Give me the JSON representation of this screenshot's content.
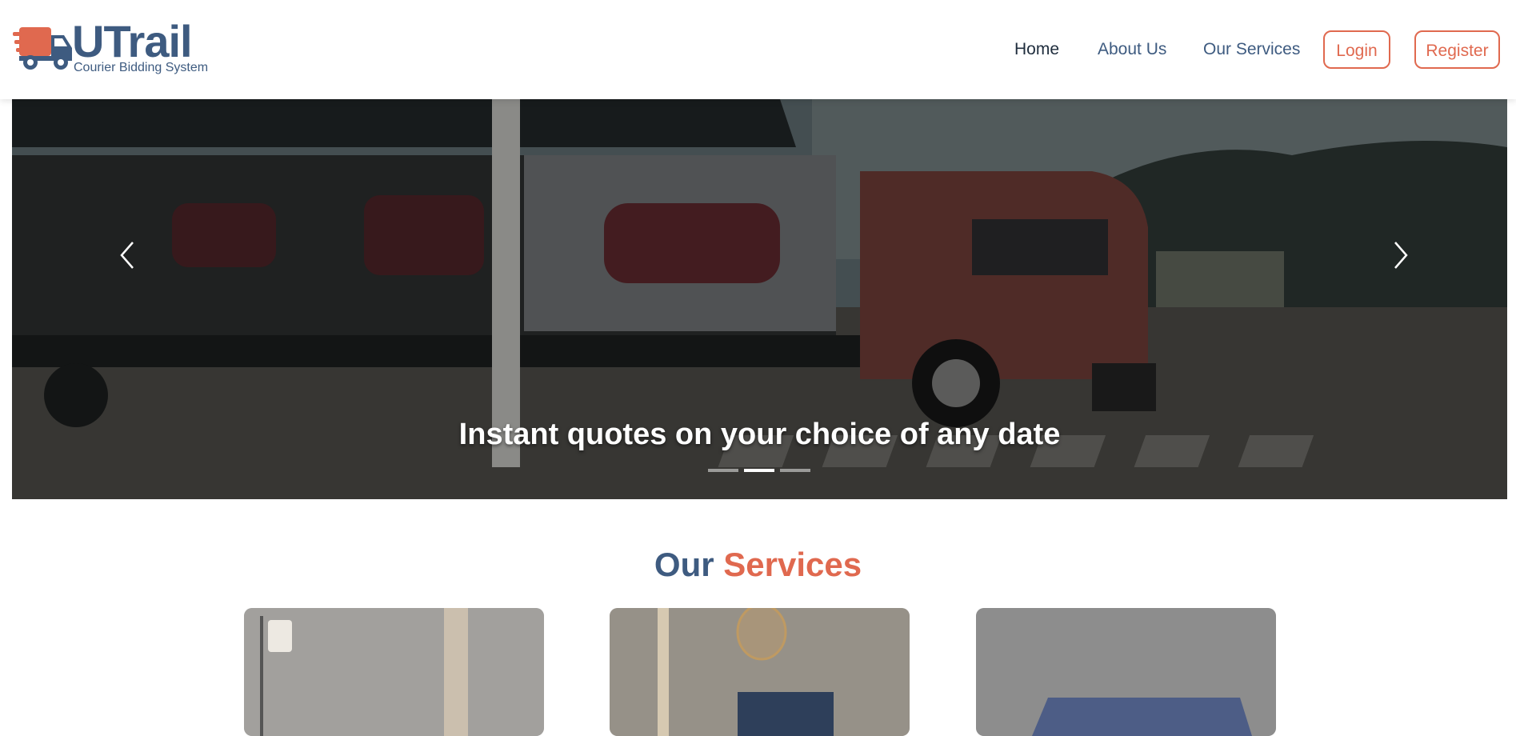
{
  "brand": {
    "name": "UTrail",
    "tagline": "Courier Bidding System"
  },
  "nav": {
    "links": [
      "Home",
      "About Us",
      "Our Services"
    ],
    "login_label": "Login",
    "register_label": "Register"
  },
  "carousel": {
    "caption": "Instant quotes on your choice of any date",
    "slide_count": 3,
    "active_index": 1
  },
  "services": {
    "title_part1": "Our",
    "title_part2": "Services"
  },
  "colors": {
    "brand_blue": "#3e5b80",
    "accent_orange": "#e0694f"
  },
  "icons": {
    "logo": "truck-icon",
    "prev": "chevron-left-icon",
    "next": "chevron-right-icon"
  }
}
